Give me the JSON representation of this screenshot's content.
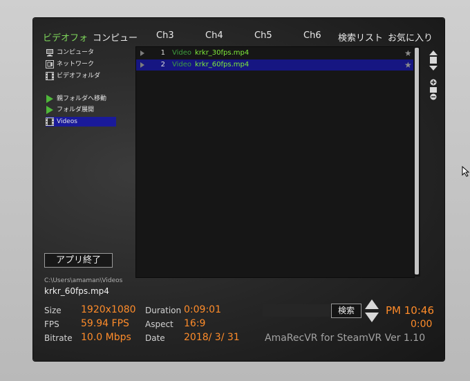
{
  "tabs": [
    {
      "label": "ビデオフォ",
      "active": true
    },
    {
      "label": "コンピュー",
      "active": false
    },
    {
      "label": "Ch3",
      "active": false
    },
    {
      "label": "Ch4",
      "active": false
    },
    {
      "label": "Ch5",
      "active": false
    },
    {
      "label": "Ch6",
      "active": false
    },
    {
      "label": "検索リスト",
      "active": false
    },
    {
      "label": "お気に入り",
      "active": false
    }
  ],
  "sidebar": {
    "items": [
      {
        "label": "コンピュータ",
        "icon": "computer-icon"
      },
      {
        "label": "ネットワーク",
        "icon": "network-icon"
      },
      {
        "label": "ビデオフォルダ",
        "icon": "film-icon"
      },
      {
        "label": "親フォルダへ移動",
        "icon": "play-icon"
      },
      {
        "label": "フォルダ展開",
        "icon": "play-icon"
      },
      {
        "label": "Videos",
        "icon": "film-icon",
        "selected": true
      }
    ]
  },
  "file_list": [
    {
      "num": "1",
      "type": "Video",
      "name": "krkr_30fps.mp4",
      "selected": false
    },
    {
      "num": "2",
      "type": "Video",
      "name": "krkr_60fps.mp4",
      "selected": true
    }
  ],
  "exit_label": "アプリ終了",
  "current_path": "C:\\Users\\amaman\\Videos",
  "current_file": "krkr_60fps.mp4",
  "info": {
    "size_label": "Size",
    "size_value": "1920x1080",
    "fps_label": "FPS",
    "fps_value": "59.94 FPS",
    "bitrate_label": "Bitrate",
    "bitrate_value": "10.0 Mbps",
    "duration_label": "Duration",
    "duration_value": "0:09:01",
    "aspect_label": "Aspect",
    "aspect_value": "16:9",
    "date_label": "Date",
    "date_value": "2018/ 3/ 31"
  },
  "search_label": "検索",
  "time": "PM 10:46",
  "elapsed": "0:00",
  "version": "AmaRecVR for SteamVR Ver 1.10",
  "colors": {
    "accent_orange": "#ff8c2a",
    "active_tab_green": "#7fd85b",
    "filename_green": "#7fea3b",
    "selection_blue": "#161682"
  }
}
